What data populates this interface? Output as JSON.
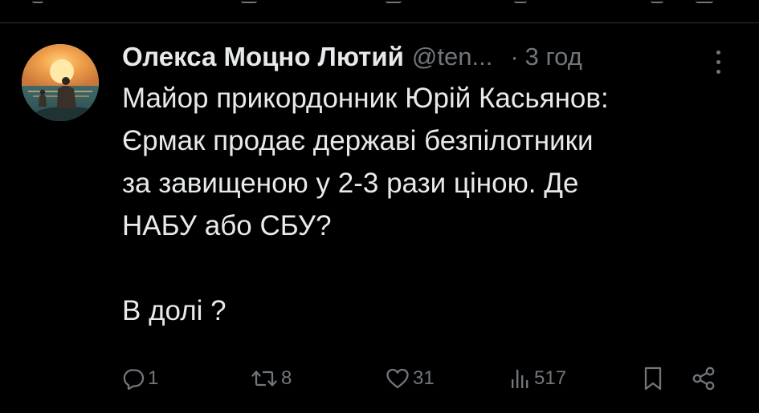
{
  "tweet": {
    "display_name": "Олекса Моцно Лютий",
    "handle": "@ten...",
    "separator": "·",
    "time": "3 год",
    "text_lines": [
      "Майор прикордонник Юрій Касьянов:",
      "Єрмак продає державі безпілотники",
      "за завищеною у 2-3 рази ціною. Де",
      "НАБУ або СБУ?",
      "",
      "В долі ?"
    ]
  },
  "actions": {
    "reply_count": "1",
    "retweet_count": "8",
    "like_count": "31",
    "views_count": "517"
  },
  "icons": {
    "reply": "reply-icon",
    "retweet": "retweet-icon",
    "like": "heart-icon",
    "views": "views-icon",
    "bookmark": "bookmark-icon",
    "share": "share-icon",
    "more": "more-icon"
  },
  "colors": {
    "background": "#000000",
    "primary_text": "#e7e9ea",
    "secondary_text": "#71767b",
    "divider": "#2f3336"
  }
}
